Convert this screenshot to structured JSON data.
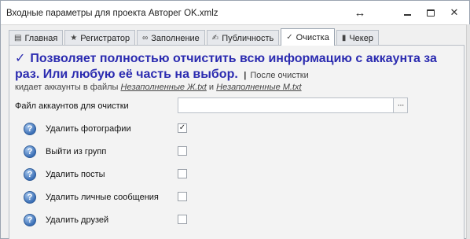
{
  "window": {
    "title": "Входные параметры для проекта Авторег OK.xmlz"
  },
  "titlebar_icons": {
    "resize": "↔",
    "minimize": "minimize-icon",
    "maximize": "maximize-icon",
    "close": "✕"
  },
  "tabs": [
    {
      "icon": "▤",
      "label": "Главная",
      "active": false
    },
    {
      "icon": "★",
      "label": "Регистратор",
      "active": false
    },
    {
      "icon": "∞",
      "label": "Заполнение",
      "active": false
    },
    {
      "icon": "✍",
      "label": "Публичность",
      "active": false
    },
    {
      "icon": "✓",
      "label": "Очистка",
      "active": true
    },
    {
      "icon": "▮",
      "label": "Чекер",
      "active": false
    }
  ],
  "content": {
    "headline_check": "✓",
    "headline": "Позволяет полностью отчистить всю информацию с аккаунта за раз. Или любую её часть на выбор.",
    "sub_sep": "|",
    "sub_part1": "После очистки",
    "sub_part2": "кидает аккаунты в файлы",
    "link1": "Незаполненные Ж.txt",
    "sub_and": "и",
    "link2": "Незаполненные М.txt"
  },
  "file_field": {
    "label": "Файл аккаунтов для очистки",
    "value": "",
    "browse": "···"
  },
  "options": [
    {
      "label": "Удалить фотографии",
      "checked": true
    },
    {
      "label": "Выйти из групп",
      "checked": false
    },
    {
      "label": "Удалить посты",
      "checked": false
    },
    {
      "label": "Удалить личные сообщения",
      "checked": false
    },
    {
      "label": "Удалить друзей",
      "checked": false
    }
  ],
  "help_glyph": "?",
  "check_glyph": "✓",
  "colors": {
    "headline": "#2b2bb0",
    "help_icon": "#3b6fb6"
  }
}
